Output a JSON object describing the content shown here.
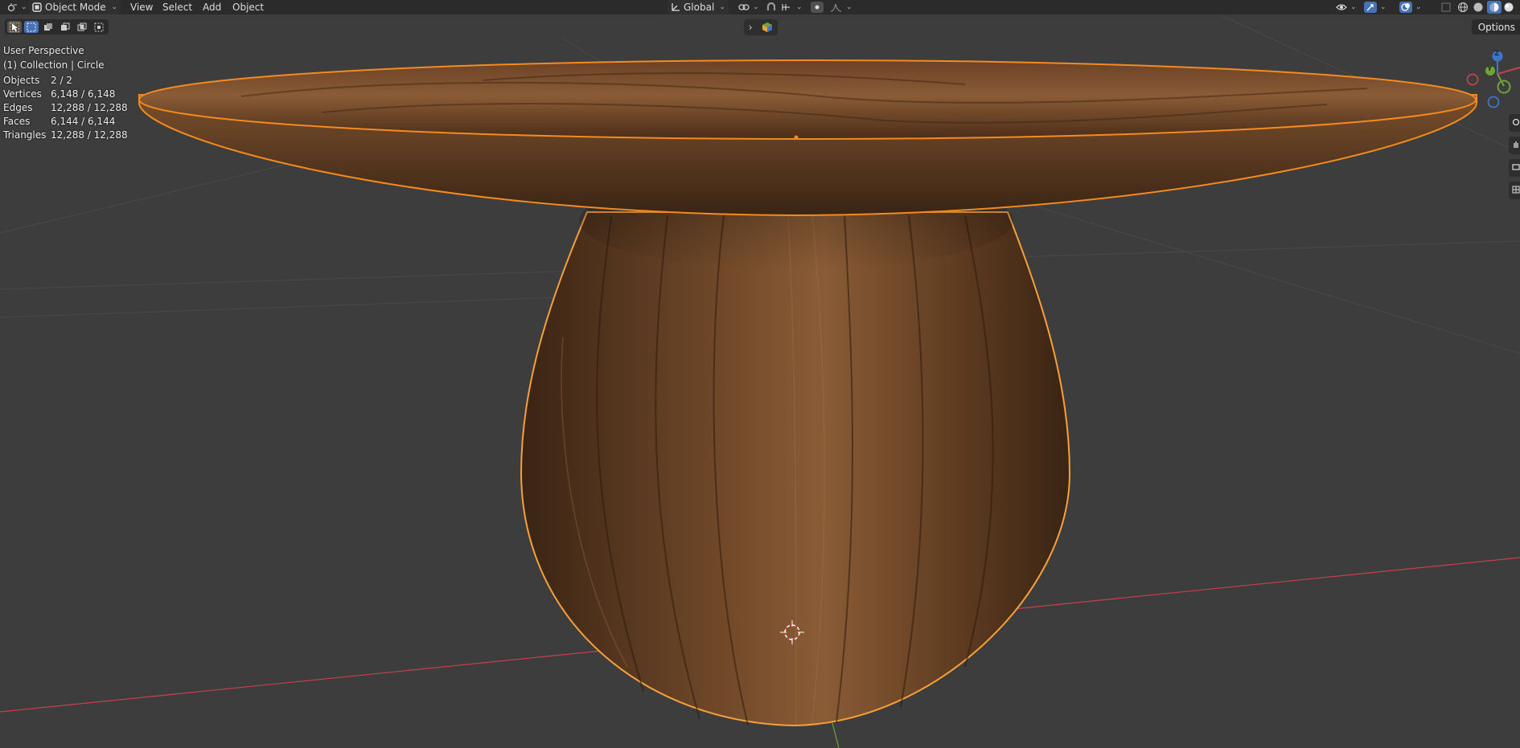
{
  "header": {
    "mode_label": "Object Mode",
    "menus": [
      "View",
      "Select",
      "Add",
      "Object"
    ],
    "transform_orientation": "Global"
  },
  "viewport": {
    "perspective_label": "User Perspective",
    "collection_label": "(1) Collection | Circle",
    "options_label": "Options",
    "stats": [
      {
        "key": "Objects",
        "value": "2 / 2"
      },
      {
        "key": "Vertices",
        "value": "6,148 / 6,148"
      },
      {
        "key": "Edges",
        "value": "12,288 / 12,288"
      },
      {
        "key": "Faces",
        "value": "6,144 / 6,144"
      },
      {
        "key": "Triangles",
        "value": "12,288 / 12,288"
      }
    ],
    "gizmo_axes": {
      "z": "Z",
      "y": "Y"
    }
  },
  "colors": {
    "header_bg": "#2b2b2b",
    "viewport_bg": "#3d3d3d",
    "selection_outline": "#f58a1f",
    "active_tool": "#4772b3",
    "wood_dark": "#3a2414",
    "wood_light": "#8a5a33",
    "axis_x": "#c5424c",
    "axis_y": "#6ea23a",
    "axis_z": "#3b77c9"
  }
}
